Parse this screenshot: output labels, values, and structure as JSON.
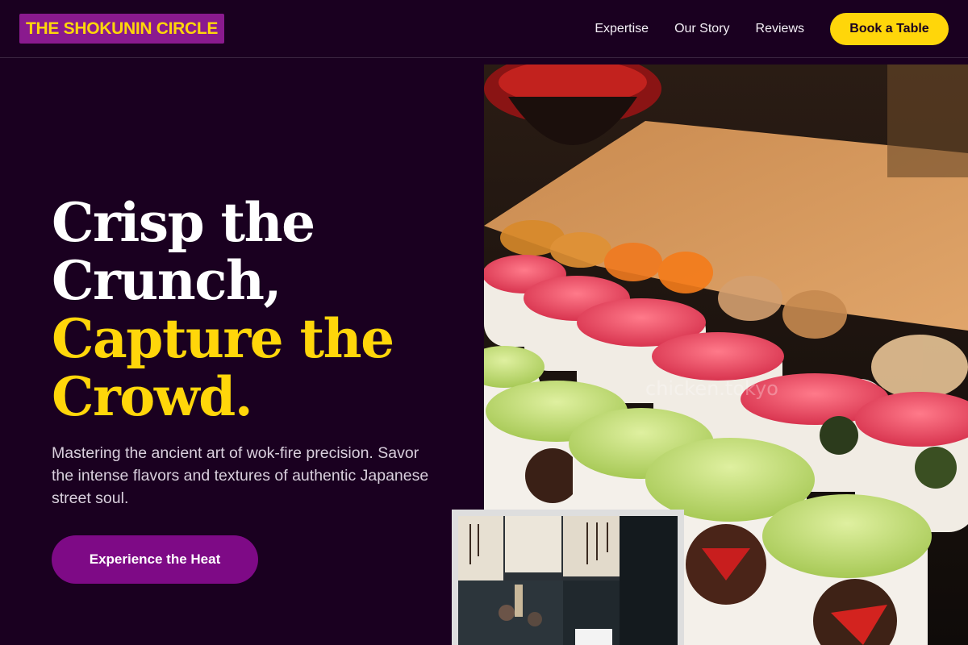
{
  "header": {
    "logo": "THE SHOKUNIN CIRCLE",
    "nav": [
      "Expertise",
      "Our Story",
      "Reviews"
    ],
    "cta": "Book a Table"
  },
  "hero": {
    "headline_line1": "Crisp the",
    "headline_line2": "Crunch,",
    "headline_line3": "Capture the",
    "headline_line4": "Crowd.",
    "subtitle": "Mastering the ancient art of wok-fire precision. Savor the intense flavors and textures of authentic Japanese street soul.",
    "cta": "Experience the Heat",
    "photo_watermark": "chicken.tokyo"
  },
  "colors": {
    "background": "#1a0020",
    "accent_gold": "#ffd60a",
    "accent_purple": "#7e0a86"
  }
}
